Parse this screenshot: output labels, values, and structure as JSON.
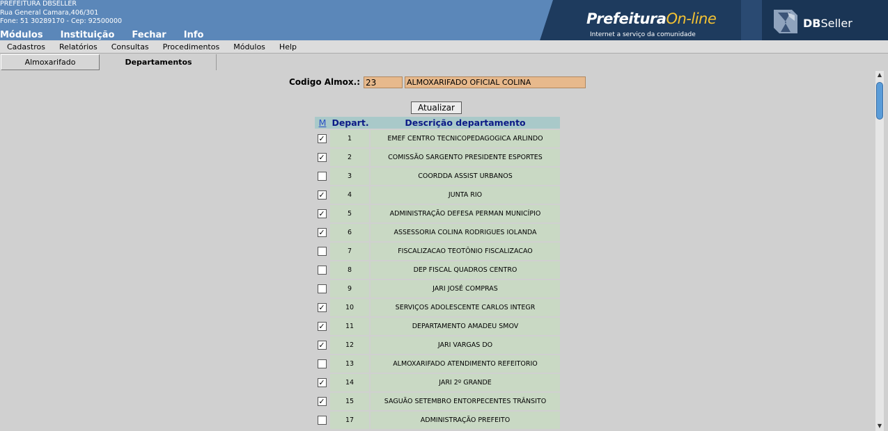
{
  "header": {
    "org_name": "PREFEITURA DBSELLER",
    "address": "Rua General Camara,406/301",
    "phone_line": "Fone: 51 30289170  -  Cep: 92500000",
    "top_menu": [
      "Módulos",
      "Instituição",
      "Fechar",
      "Info"
    ],
    "logo_word": "Prefeitura",
    "logo_online": "On-line",
    "logo_tagline": "Internet a serviço da comunidade",
    "dbseller_bold": "DB",
    "dbseller_rest": "Seller"
  },
  "menubar": [
    "Cadastros",
    "Relatórios",
    "Consultas",
    "Procedimentos",
    "Módulos",
    "Help"
  ],
  "tabs": [
    {
      "label": "Almoxarifado",
      "active": false
    },
    {
      "label": "Departamentos",
      "active": true
    }
  ],
  "form": {
    "codigo_label": "Codigo Almox.:",
    "codigo_value": "23",
    "descricao_value": "ALMOXARIFADO OFICIAL COLINA",
    "update_button": "Atualizar"
  },
  "table": {
    "headers": {
      "mark": "M",
      "depart": "Depart.",
      "descricao": "Descrição departamento"
    },
    "rows": [
      {
        "checked": true,
        "depart": "1",
        "descricao": "EMEF CENTRO TECNICOPEDAGOGICA ARLINDO"
      },
      {
        "checked": true,
        "depart": "2",
        "descricao": "COMISSÃO SARGENTO PRESIDENTE ESPORTES"
      },
      {
        "checked": false,
        "depart": "3",
        "descricao": "COORDDA ASSIST URBANOS"
      },
      {
        "checked": true,
        "depart": "4",
        "descricao": "JUNTA RIO"
      },
      {
        "checked": true,
        "depart": "5",
        "descricao": "ADMINISTRAÇÃO DEFESA PERMAN MUNICÍPIO"
      },
      {
        "checked": true,
        "depart": "6",
        "descricao": "ASSESSORIA COLINA RODRIGUES IOLANDA"
      },
      {
        "checked": false,
        "depart": "7",
        "descricao": "FISCALIZACAO TEOTÔNIO FISCALIZACAO"
      },
      {
        "checked": false,
        "depart": "8",
        "descricao": "DEP FISCAL QUADROS CENTRO"
      },
      {
        "checked": false,
        "depart": "9",
        "descricao": "JARI JOSÉ COMPRAS"
      },
      {
        "checked": true,
        "depart": "10",
        "descricao": "SERVIÇOS ADOLESCENTE CARLOS INTEGR"
      },
      {
        "checked": true,
        "depart": "11",
        "descricao": "DEPARTAMENTO AMADEU SMOV"
      },
      {
        "checked": true,
        "depart": "12",
        "descricao": "JARI VARGAS DO"
      },
      {
        "checked": false,
        "depart": "13",
        "descricao": "ALMOXARIFADO ATENDIMENTO REFEITORIO"
      },
      {
        "checked": true,
        "depart": "14",
        "descricao": "JARI 2º GRANDE"
      },
      {
        "checked": true,
        "depart": "15",
        "descricao": "SAGUÃO SETEMBRO ENTORPECENTES TRÂNSITO"
      },
      {
        "checked": false,
        "depart": "17",
        "descricao": "ADMINISTRAÇÃO PREFEITO"
      }
    ]
  },
  "icons": {
    "check": "✓",
    "scroll_up": "▲",
    "scroll_down": "▼"
  }
}
